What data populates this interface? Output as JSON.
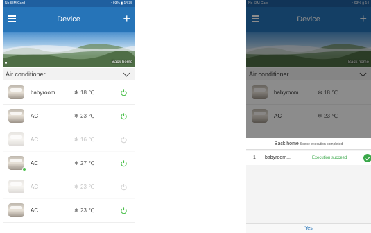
{
  "colors": {
    "header": "#2674b8",
    "status_bar": "#1f5f9f",
    "power_green": "#4cc04c",
    "success_green": "#3aa84a"
  },
  "status_bar": {
    "carrier": "No SIM Card",
    "right_text_left": "93%",
    "time_left": "14:35",
    "right_text_right": "93%",
    "time_right": "14"
  },
  "header": {
    "title": "Device",
    "menu_icon": "hamburger-menu-icon",
    "add_icon": "plus-icon"
  },
  "banner": {
    "scene_label": "Back home"
  },
  "section": {
    "label": "Air conditioner"
  },
  "devices": [
    {
      "name": "babyroom",
      "mode_icon": "fan-icon",
      "mode_glyph": "✻",
      "temp": "18 ℃",
      "online": true
    },
    {
      "name": "AC",
      "mode_icon": "snowflake-icon",
      "mode_glyph": "❄",
      "temp": "23 ℃",
      "online": true
    },
    {
      "name": "AC",
      "mode_icon": "fan-icon",
      "mode_glyph": "✻",
      "temp": "16 ℃",
      "online": false
    },
    {
      "name": "AC",
      "mode_icon": "snowflake-icon",
      "mode_glyph": "❄",
      "temp": "27 ℃",
      "online": true
    },
    {
      "name": "AC",
      "mode_icon": "snowflake-icon",
      "mode_glyph": "❄",
      "temp": "23 ℃",
      "online": false
    },
    {
      "name": "AC",
      "mode_icon": "snowflake-icon",
      "mode_glyph": "❄",
      "temp": "23 ℃",
      "online": true
    }
  ],
  "dialog": {
    "scene": "Back home",
    "message": "Scene execution completed",
    "results": [
      {
        "index": "1",
        "device": "babyroom...",
        "status": "Execution succeed"
      }
    ],
    "confirm": "Yes"
  }
}
